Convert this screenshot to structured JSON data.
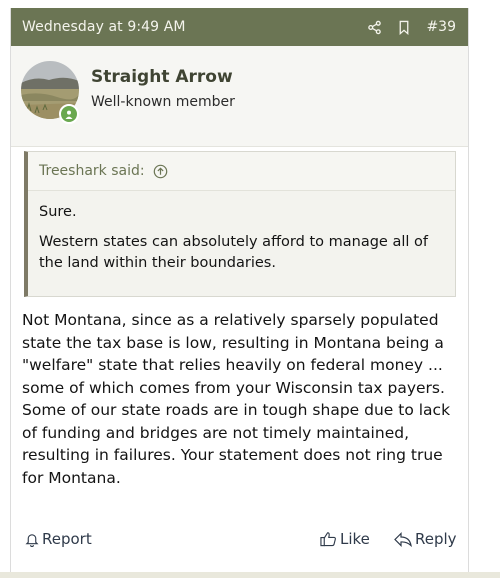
{
  "post": {
    "timestamp": "Wednesday at 9:49 AM",
    "number": "#39",
    "header_icons": [
      "share-icon",
      "bookmark-icon"
    ]
  },
  "user": {
    "name": "Straight Arrow",
    "title": "Well-known member",
    "online": true
  },
  "quote": {
    "author_line": "Treeshark said:",
    "paragraphs": [
      "Sure.",
      "Western states can absolutely afford to manage all of the land within their boundaries."
    ]
  },
  "message": "Not Montana, since as a relatively sparsely populated state the tax base is low, resulting in Montana being a \"welfare\" state that relies heavily on federal money ... some of which comes from your Wisconsin tax payers. Some of our state roads are in tough shape due to lack of funding and bridges are not timely maintained, resulting in failures. Your statement does not ring true for Montana.",
  "actions": {
    "report": "Report",
    "like": "Like",
    "reply": "Reply"
  },
  "colors": {
    "header_bg": "#6b7554",
    "accent_text": "#6b7554",
    "online": "#6aa84f"
  }
}
